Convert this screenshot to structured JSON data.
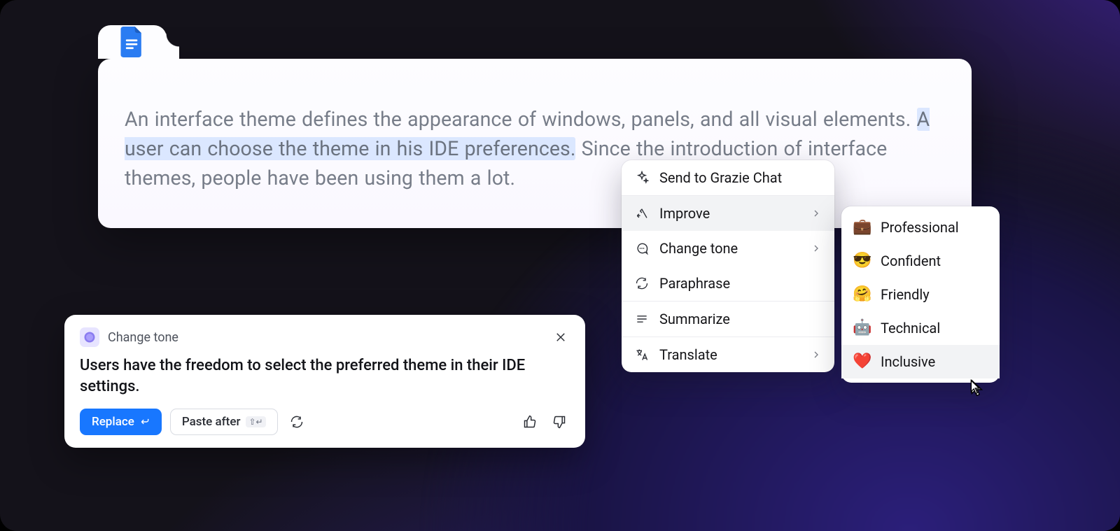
{
  "document": {
    "text_before": "An interface theme defines the appearance of windows, panels, and all visual elements. ",
    "text_selected": "A user can choose the theme in his IDE preferences.",
    "text_mid": " Since the introduction of interface themes, people have been using them a lot."
  },
  "context_menu": {
    "send_label": "Send to Grazie Chat",
    "items": [
      {
        "label": "Improve",
        "icon": "improve",
        "submenu": true,
        "active": true
      },
      {
        "label": "Change tone",
        "icon": "chat",
        "submenu": true
      },
      {
        "label": "Paraphrase",
        "icon": "refresh-cw"
      },
      {
        "label": "Summarize",
        "icon": "text-lines",
        "sep_before": true
      },
      {
        "label": "Translate",
        "icon": "translate",
        "submenu": true,
        "sep_before": true
      }
    ]
  },
  "tone_menu": {
    "items": [
      {
        "label": "Professional",
        "emoji": "💼"
      },
      {
        "label": "Confident",
        "emoji": "😎"
      },
      {
        "label": "Friendly",
        "emoji": "🤗"
      },
      {
        "label": "Technical",
        "emoji": "🤖"
      },
      {
        "label": "Inclusive",
        "emoji": "❤️",
        "active": true
      }
    ]
  },
  "suggestion": {
    "title": "Change tone",
    "body": "Users have the freedom to select the preferred theme in their IDE settings.",
    "replace_label": "Replace",
    "paste_after_label": "Paste after",
    "paste_after_hint": "⇧↵"
  }
}
